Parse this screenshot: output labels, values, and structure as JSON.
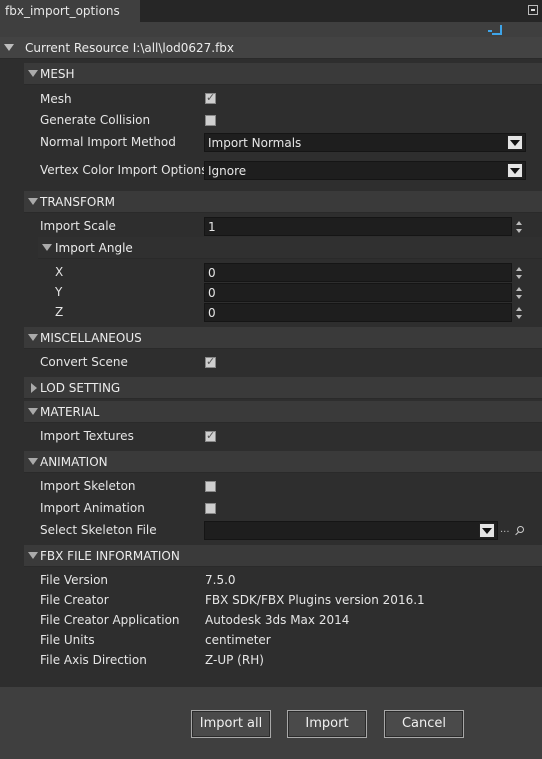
{
  "window": {
    "tab_title": "fbx_import_options"
  },
  "resource": {
    "label": "Current Resource I:\\all\\lod0627.fbx"
  },
  "mesh": {
    "header": "MESH",
    "mesh_label": "Mesh",
    "mesh_checked": true,
    "generate_collision_label": "Generate Collision",
    "generate_collision_checked": false,
    "normal_import_method_label": "Normal Import Method",
    "normal_import_method_value": "Import Normals",
    "vertex_color_label": "Vertex Color Import Options",
    "vertex_color_value": "Ignore"
  },
  "transform": {
    "header": "TRANSFORM",
    "import_scale_label": "Import Scale",
    "import_scale_value": "1",
    "import_angle_header": "Import Angle",
    "x_label": "X",
    "x_value": "0",
    "y_label": "Y",
    "y_value": "0",
    "z_label": "Z",
    "z_value": "0"
  },
  "miscellaneous": {
    "header": "MISCELLANEOUS",
    "convert_scene_label": "Convert Scene",
    "convert_scene_checked": true
  },
  "lod": {
    "header": "LOD SETTING"
  },
  "material": {
    "header": "MATERIAL",
    "import_textures_label": "Import Textures",
    "import_textures_checked": true
  },
  "animation": {
    "header": "ANIMATION",
    "import_skeleton_label": "Import Skeleton",
    "import_skeleton_checked": false,
    "import_animation_label": "Import Animation",
    "import_animation_checked": false,
    "select_skeleton_label": "Select Skeleton File",
    "select_skeleton_value": "",
    "browse_dots": "..."
  },
  "fbx_info": {
    "header": "FBX FILE INFORMATION",
    "file_version_label": "File Version",
    "file_version_value": "7.5.0",
    "file_creator_label": "File Creator",
    "file_creator_value": "FBX SDK/FBX Plugins version 2016.1",
    "file_creator_app_label": "File Creator Application",
    "file_creator_app_value": "Autodesk 3ds Max 2014",
    "file_units_label": "File Units",
    "file_units_value": "centimeter",
    "file_axis_label": "File Axis Direction",
    "file_axis_value": "Z-UP (RH)"
  },
  "buttons": {
    "import_all": "Import all",
    "import": "Import",
    "cancel": "Cancel"
  },
  "icons": {
    "pin": "pin-icon",
    "refresh": "refresh-icon",
    "search": "search-icon"
  },
  "colors": {
    "panel_bg": "#2e2e2e",
    "header_bg": "#3a3a3a",
    "accent": "#3ea4e8"
  }
}
